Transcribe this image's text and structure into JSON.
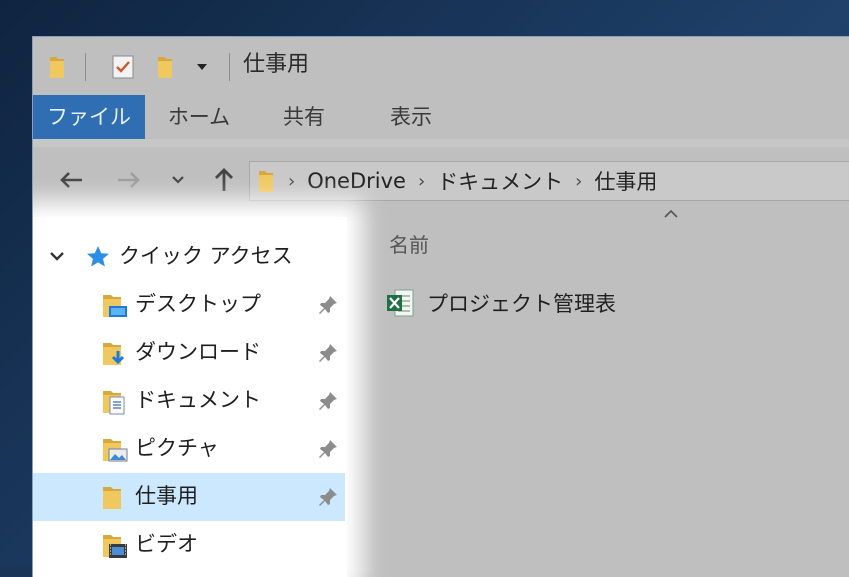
{
  "window": {
    "title": "仕事用"
  },
  "ribbon": {
    "tabs": [
      {
        "label": "ファイル",
        "active": true
      },
      {
        "label": "ホーム",
        "active": false
      },
      {
        "label": "共有",
        "active": false
      },
      {
        "label": "表示",
        "active": false
      }
    ]
  },
  "address_bar": {
    "crumbs": [
      "OneDrive",
      "ドキュメント",
      "仕事用"
    ]
  },
  "sidebar": {
    "quick_access_label": "クイック アクセス",
    "items": [
      {
        "label": "デスクトップ",
        "icon": "desktop-folder-icon",
        "pinned": true
      },
      {
        "label": "ダウンロード",
        "icon": "downloads-folder-icon",
        "pinned": true
      },
      {
        "label": "ドキュメント",
        "icon": "documents-folder-icon",
        "pinned": true
      },
      {
        "label": "ピクチャ",
        "icon": "pictures-folder-icon",
        "pinned": true
      },
      {
        "label": "仕事用",
        "icon": "folder-icon",
        "pinned": true,
        "selected": true
      },
      {
        "label": "ビデオ",
        "icon": "videos-folder-icon",
        "pinned": false
      }
    ]
  },
  "content": {
    "column_header": "名前",
    "files": [
      {
        "name": "プロジェクト管理表",
        "icon": "excel-file-icon"
      }
    ]
  },
  "colors": {
    "accent": "#2f6eb3",
    "selection": "#cce8ff",
    "folder": "#e8b94a"
  }
}
